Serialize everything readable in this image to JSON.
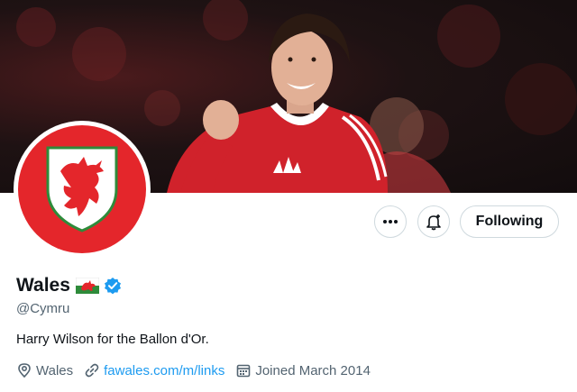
{
  "profile": {
    "display_name": "Wales",
    "handle": "@Cymru",
    "bio": "Harry Wilson for the Ballon d'Or.",
    "location": "Wales",
    "website": "fawales.com/m/links",
    "joined": "Joined March 2014",
    "verified": true
  },
  "actions": {
    "follow_label": "Following"
  },
  "icons": {
    "more": "more-icon",
    "notify": "notification-bell-icon",
    "verified": "verified-badge-icon",
    "location": "location-pin-icon",
    "link": "link-icon",
    "calendar": "calendar-icon"
  },
  "colors": {
    "accent": "#1d9bf0",
    "avatar_red": "#e4262b",
    "welsh_green": "#2e8b3a"
  }
}
